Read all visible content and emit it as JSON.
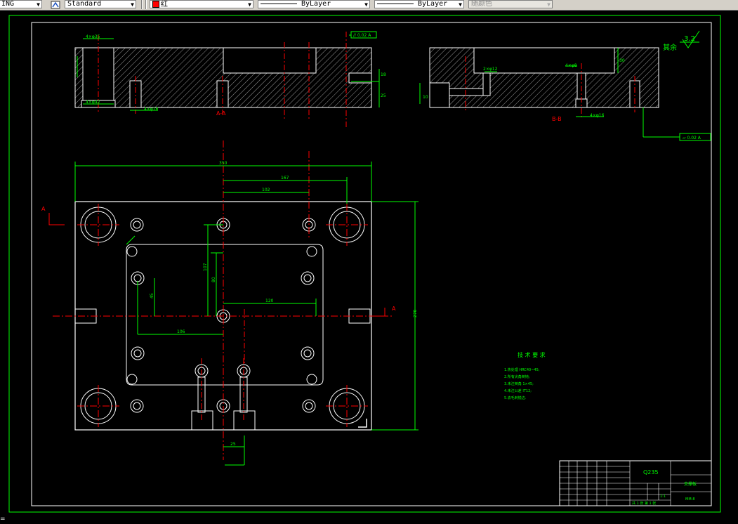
{
  "toolbar": {
    "combo_cut_value": "ING",
    "text_style_value": "Standard",
    "color_value": "红",
    "linetype_value": "ByLayer",
    "lineweight_value": "ByLayer",
    "plotstyle_value": "随颜色"
  },
  "drawing": {
    "section_aa": "A-A",
    "section_bb": "B-B",
    "view_marker_a_left": "A",
    "view_marker_a_right": "A",
    "roughness_label": "其余",
    "roughness_value": "3.2",
    "tech_title": "技 术 要 求",
    "tech_items": [
      "1.热处理 HRC40~45;",
      "2.所有尖角倒钝;",
      "3.未注倒角 1×45;",
      "4.未注公差 IT12;",
      "5.去毛刺锐边."
    ],
    "dim_width": "350",
    "dim_half": "167",
    "dim_102": "102",
    "dim_height": "270",
    "dim_80": "80",
    "dim_107": "107",
    "dim_120": "120",
    "dim_106": "106",
    "dim_45": "45",
    "dim_25": "25",
    "dim_aa_hole": "4×φ35",
    "dim_aa_hole2": "4×φ42",
    "dim_aa_pin": "4×φ16",
    "dim_bb_hole": "4×φ8",
    "dim_bb_hole2": "4×φ16",
    "dim_bb_side": "2×φ12",
    "dim_bb_10": "10",
    "dim_bb_30": "30",
    "dim_aa_25": "25",
    "dim_aa_18": "18",
    "gdt_top": "// 0.02 A",
    "gdt_bottom": "⏥ 0.02 A",
    "title_block": {
      "material": "Q235",
      "part_name": "支撑板",
      "scale": "1:1",
      "drawing_no": "MM-8",
      "sheet": "共 1 张  第 1 张"
    }
  }
}
